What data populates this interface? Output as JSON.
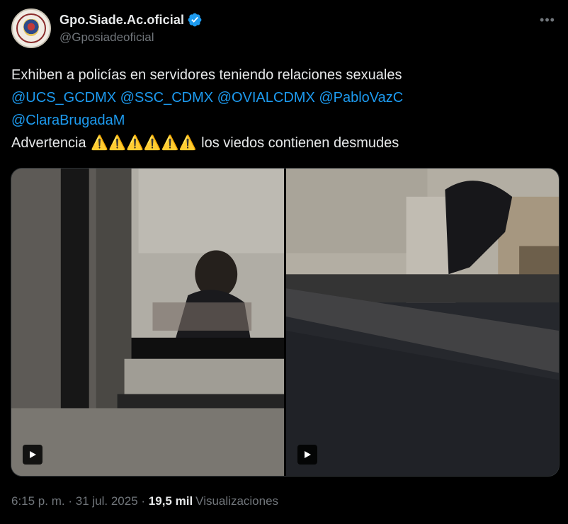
{
  "author": {
    "display_name": "Gpo.Siade.Ac.oficial",
    "handle": "@Gposiadeoficial",
    "verified": true,
    "avatar_icon": "organization-seal-avatar"
  },
  "more_icon": "more-options-icon",
  "more_glyph": "•••",
  "tweet": {
    "line1": "Exhiben a policías en servidores teniendo relaciones sexuales",
    "mentions_line2": [
      "@UCS_GCDMX",
      "@SSC_CDMX",
      "@OVIALCDMX",
      "@PabloVazC"
    ],
    "mentions_line3": [
      "@ClaraBrugadaM"
    ],
    "warning_prefix": "Advertencia",
    "warning_emoji": "⚠️⚠️⚠️⚠️⚠️⚠️",
    "warning_suffix": "los viedos contienen desmudes"
  },
  "media": {
    "count": 2,
    "items": [
      {
        "type": "video",
        "icon": "play-icon"
      },
      {
        "type": "video",
        "icon": "play-icon"
      }
    ]
  },
  "footer": {
    "time": "6:15 p. m.",
    "separator": "·",
    "date": "31 jul. 2025",
    "views_count": "19,5 mil",
    "views_label": "Visualizaciones"
  },
  "colors": {
    "background": "#000000",
    "text_primary": "#e7e9ea",
    "text_secondary": "#71767b",
    "link": "#1d9bf0",
    "verified_badge": "#1d9bf0"
  }
}
